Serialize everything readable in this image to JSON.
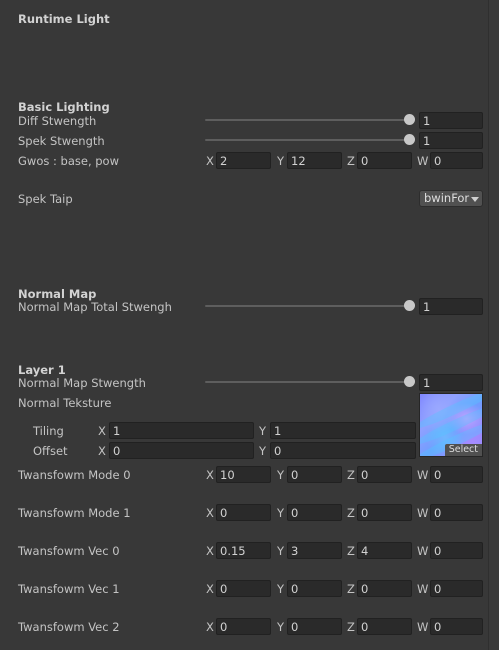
{
  "header": {
    "title": "Runtime Light"
  },
  "basic": {
    "section": "Basic Lighting",
    "diff": {
      "label": "Diff Stwength",
      "value": "1",
      "fraction": 1.0
    },
    "spek": {
      "label": "Spek Stwength",
      "value": "1",
      "fraction": 1.0
    },
    "glows": {
      "label": "Gwos : base, pow",
      "x": "2",
      "y": "12",
      "z": "0",
      "w": "0"
    },
    "spek_type": {
      "label": "Spek Taip",
      "value": "bwinFor"
    }
  },
  "normal_map": {
    "section": "Normal Map",
    "total": {
      "label": "Normal Map Total Stwengh",
      "value": "1",
      "fraction": 1.0
    }
  },
  "layer1": {
    "section": "Layer 1",
    "strength": {
      "label": "Normal Map Stwength",
      "value": "1",
      "fraction": 1.0
    },
    "texture": {
      "label": "Normal Teksture",
      "select": "Select"
    },
    "tiling": {
      "label": "Tiling",
      "x": "1",
      "y": "1"
    },
    "offset": {
      "label": "Offset",
      "x": "0",
      "y": "0"
    }
  },
  "axis_labels": {
    "x": "X",
    "y": "Y",
    "z": "Z",
    "w": "W"
  },
  "transforms": [
    {
      "label": "Twansfowm Mode 0",
      "x": "10",
      "y": "0",
      "z": "0",
      "w": "0"
    },
    {
      "label": "Twansfowm Mode 1",
      "x": "0",
      "y": "0",
      "z": "0",
      "w": "0"
    },
    {
      "label": "Twansfowm Vec 0",
      "x": "0.15",
      "y": "3",
      "z": "4",
      "w": "0"
    },
    {
      "label": "Twansfowm Vec 1",
      "x": "0",
      "y": "0",
      "z": "0",
      "w": "0"
    },
    {
      "label": "Twansfowm Vec 2",
      "x": "0",
      "y": "0",
      "z": "0",
      "w": "0"
    }
  ],
  "colors": {
    "background": "#383838",
    "field": "#2a2a2a",
    "text": "#c4c4c4"
  }
}
